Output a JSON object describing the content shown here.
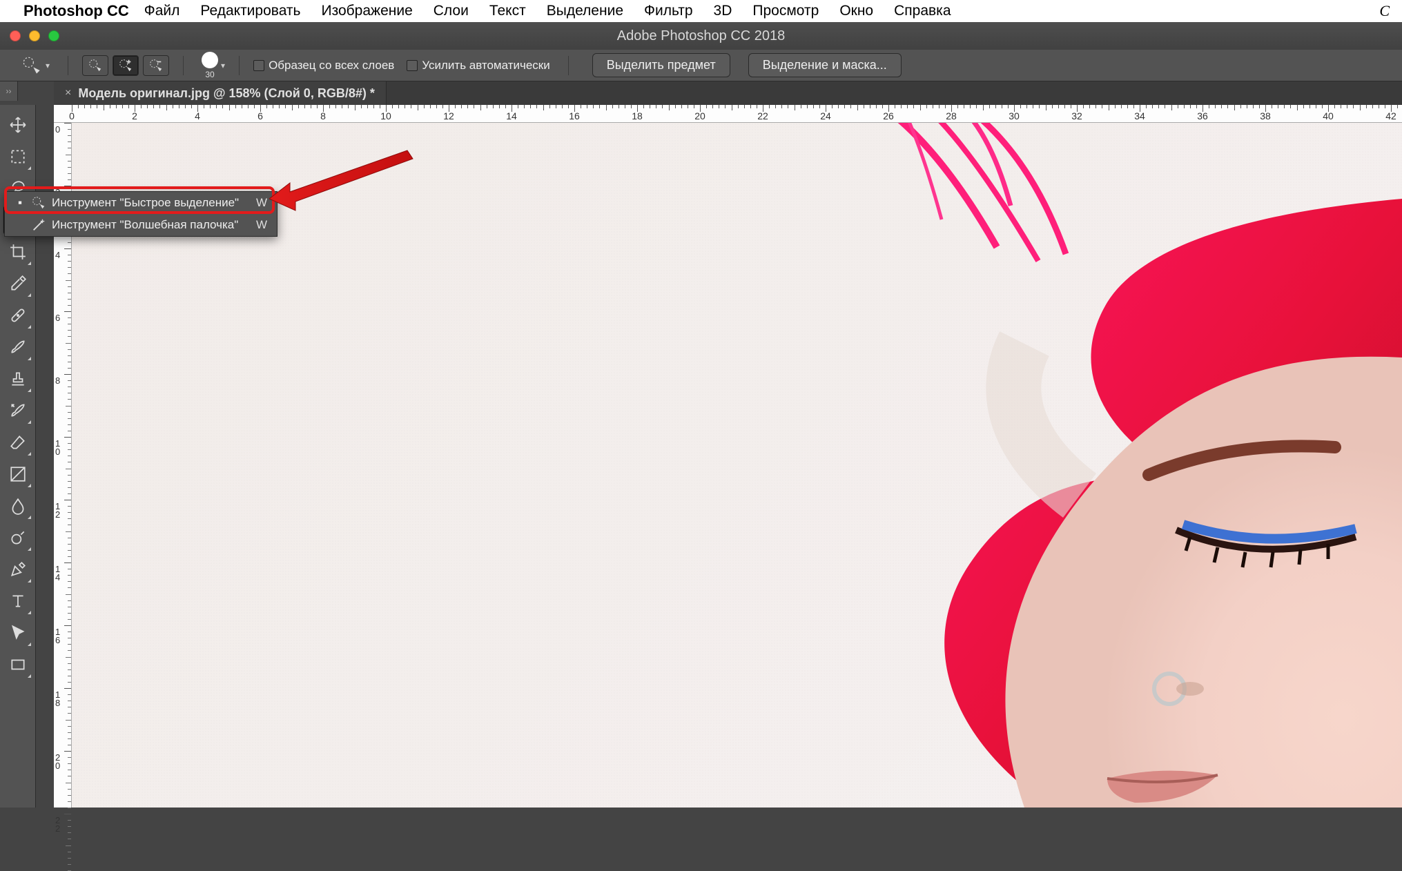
{
  "mac_menu": {
    "app_name": "Photoshop CC",
    "items": [
      "Файл",
      "Редактировать",
      "Изображение",
      "Слои",
      "Текст",
      "Выделение",
      "Фильтр",
      "3D",
      "Просмотр",
      "Окно",
      "Справка"
    ]
  },
  "window": {
    "title": "Adobe Photoshop CC 2018"
  },
  "options_bar": {
    "brush_size": "30",
    "sample_all_layers": "Образец со всех слоев",
    "auto_enhance": "Усилить автоматически",
    "select_subject_btn": "Выделить предмет",
    "select_and_mask_btn": "Выделение и маска..."
  },
  "doc_tab": {
    "title": "Модель оригинал.jpg @ 158% (Слой 0, RGB/8#) *"
  },
  "ruler": {
    "h_ticks": [
      "0",
      "2",
      "4",
      "6",
      "8",
      "10",
      "12",
      "14",
      "16",
      "18",
      "20",
      "22",
      "24",
      "26",
      "28",
      "30",
      "32",
      "34",
      "36",
      "38",
      "40",
      "42"
    ],
    "v_ticks": [
      "0",
      "2",
      "4",
      "6",
      "8",
      "10",
      "12",
      "14",
      "16",
      "18",
      "20",
      "22"
    ]
  },
  "flyout": {
    "items": [
      {
        "label": "Инструмент \"Быстрое выделение\"",
        "shortcut": "W",
        "selected": true
      },
      {
        "label": "Инструмент \"Волшебная палочка\"",
        "shortcut": "W",
        "selected": false
      }
    ]
  },
  "tools": [
    "move",
    "marquee",
    "lasso",
    "quick-select",
    "crop",
    "eyedropper",
    "healing",
    "brush",
    "clone",
    "history-brush",
    "eraser",
    "gradient",
    "blur",
    "dodge",
    "pen",
    "type",
    "path-select",
    "rectangle"
  ]
}
